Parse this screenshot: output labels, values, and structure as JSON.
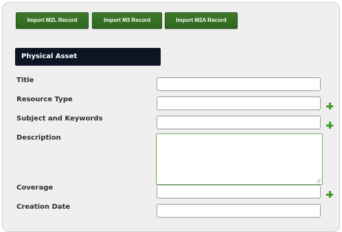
{
  "toolbar": {
    "buttons": [
      {
        "label": "Import M2L Record"
      },
      {
        "label": "Import M3 Record"
      },
      {
        "label": "Import M2A Record"
      }
    ]
  },
  "section": {
    "title": "Physical Asset"
  },
  "fields": [
    {
      "label": "Title",
      "value": ""
    },
    {
      "label": "Resource Type",
      "value": "",
      "has_add": true
    },
    {
      "label": "Subject and Keywords",
      "value": "",
      "has_add": true
    },
    {
      "label": "Description",
      "value": "",
      "multiline": true
    },
    {
      "label": "Coverage",
      "value": "",
      "has_add": true
    },
    {
      "label": "Creation Date",
      "value": ""
    }
  ],
  "icons": {
    "add": "plus-icon"
  },
  "colors": {
    "button_green": "#2f6620",
    "header_bg": "#0d1424",
    "add_icon": "#3c9a2a",
    "textarea_focus_border": "#69b25a"
  }
}
